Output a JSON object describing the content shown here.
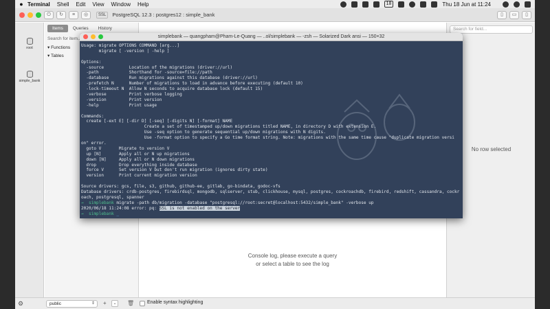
{
  "menubar": {
    "apple": "",
    "items": [
      "Terminal",
      "Shell",
      "Edit",
      "View",
      "Window",
      "Help"
    ],
    "status_badge": "18",
    "clock": "Thu 18 Jun at 11:24"
  },
  "db_app": {
    "ssl_label": "SSL",
    "connection_title": "PostgreSQL 12.3 : postgres12 : simple_bank",
    "rail": [
      {
        "label": "root"
      },
      {
        "label": "simple_bank"
      }
    ],
    "tabs": [
      "Items",
      "Queries",
      "History"
    ],
    "filter_placeholder": "Search for item...",
    "tree": [
      "Functions",
      "Tables"
    ],
    "field_search_placeholder": "Search for field...",
    "no_row": "No row selected",
    "console_msg_line1": "Console log, please execute a query",
    "console_msg_line2": "or select a table to see the log",
    "schema": "public",
    "syntax_label": "Enable syntax highlighting"
  },
  "terminal": {
    "title": "simplebank — quangpham@Pham-Le-Quang — ..ol/simplebank — -zsh — Solarized Dark ansi — 150×32",
    "lines": [
      "Usage: migrate OPTIONS COMMAND [arg...]",
      "       migrate [ -version | -help ]",
      "",
      "Options:",
      "  -source          Location of the migrations (driver://url)",
      "  -path            Shorthand for -source=file://path",
      "  -database        Run migrations against this database (driver://url)",
      "  -prefetch N      Number of migrations to load in advance before executing (default 10)",
      "  -lock-timeout N  Allow N seconds to acquire database lock (default 15)",
      "  -verbose         Print verbose logging",
      "  -version         Print version",
      "  -help            Print usage",
      "",
      "Commands:",
      "  create [-ext E] [-dir D] [-seq] [-digits N] [-format] NAME",
      "                         Create a set of timestamped up/down migrations titled NAME, in directory D with extension E.",
      "                         Use -seq option to generate sequential up/down migrations with N digits.",
      "                         Use -format option to specify a Go time format string. Note: migrations with the same time cause \"duplicate migration versi",
      "on\" error.",
      "  goto V       Migrate to version V",
      "  up [N]       Apply all or N up migrations",
      "  down [N]     Apply all or N down migrations",
      "  drop         Drop everything inside database",
      "  force V      Set version V but don't run migration (ignores dirty state)",
      "  version      Print current migration version",
      "",
      "Source drivers: gcs, file, s3, github, github-ee, gitlab, go-bindata, godoc-vfs",
      "Database drivers: crdb-postgres, firebirdsql, mongodb, sqlserver, stub, clickhouse, mysql, postgres, cockroachdb, firebird, redshift, cassandra, cockr",
      "oach, postgresql, spanner"
    ],
    "cmd_prompt": "→  simplebank",
    "cmd_text": " migrate -path db/migration -database \"postgresql://root:secret@localhost:5432/simple_bank\" -verbose up",
    "err_prefix": "2020/06/18 11:24:08 error: pq: ",
    "err_highlight": "SSL is not enabled on the server",
    "last_prompt": "→  simplebank",
    "last_cursor": " _"
  },
  "colors": {
    "terminal_bg": "#32415a",
    "prompt_green": "#4fc08d",
    "cwd_blue": "#5fb3e8",
    "traffic_red": "#fd5f57",
    "traffic_yellow": "#febc2e",
    "traffic_green": "#28c840"
  }
}
